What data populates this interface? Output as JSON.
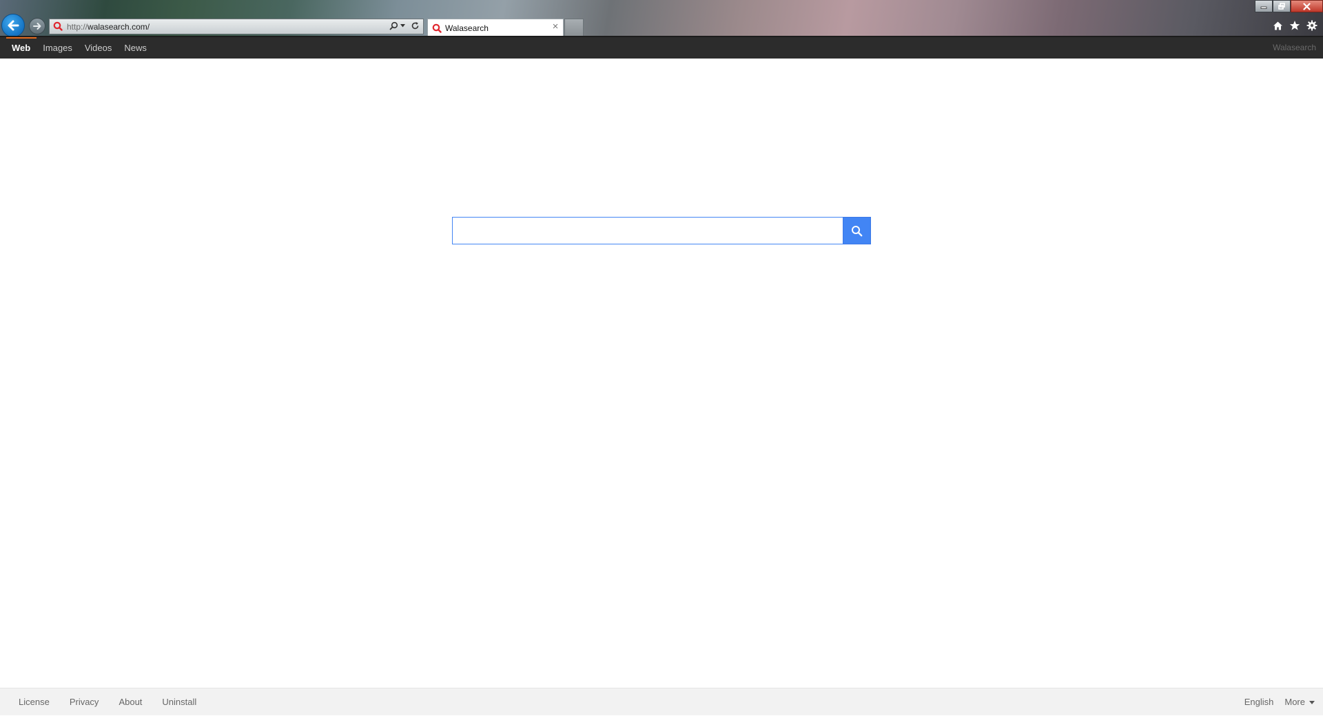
{
  "browser": {
    "address_bar": {
      "url_prefix": "http://",
      "url_host": "walasearch.com/"
    },
    "tab": {
      "title": "Walasearch",
      "close_glyph": "×"
    },
    "icons": {
      "back": "arrow-left-icon",
      "forward": "arrow-right-icon",
      "site": "walasearch-logo-icon",
      "search": "search-icon",
      "dropdown": "chevron-down-icon",
      "refresh": "refresh-icon",
      "home": "home-icon",
      "favorites": "star-icon",
      "tools": "gear-icon",
      "minimize": "minimize-icon",
      "restore": "restore-icon",
      "close": "close-icon"
    }
  },
  "site_nav": {
    "items": [
      {
        "label": "Web",
        "active": true
      },
      {
        "label": "Images",
        "active": false
      },
      {
        "label": "Videos",
        "active": false
      },
      {
        "label": "News",
        "active": false
      }
    ],
    "brand": "Walasearch"
  },
  "search": {
    "value": "",
    "placeholder": "",
    "button_icon": "search-icon"
  },
  "footer": {
    "left_links": [
      "License",
      "Privacy",
      "About",
      "Uninstall"
    ],
    "language": "English",
    "more": "More"
  },
  "colors": {
    "accent": "#4285f4",
    "nav_bg": "#2c2c2c",
    "active_underline": "#e36b1e",
    "footer_bg": "#f2f2f2"
  }
}
